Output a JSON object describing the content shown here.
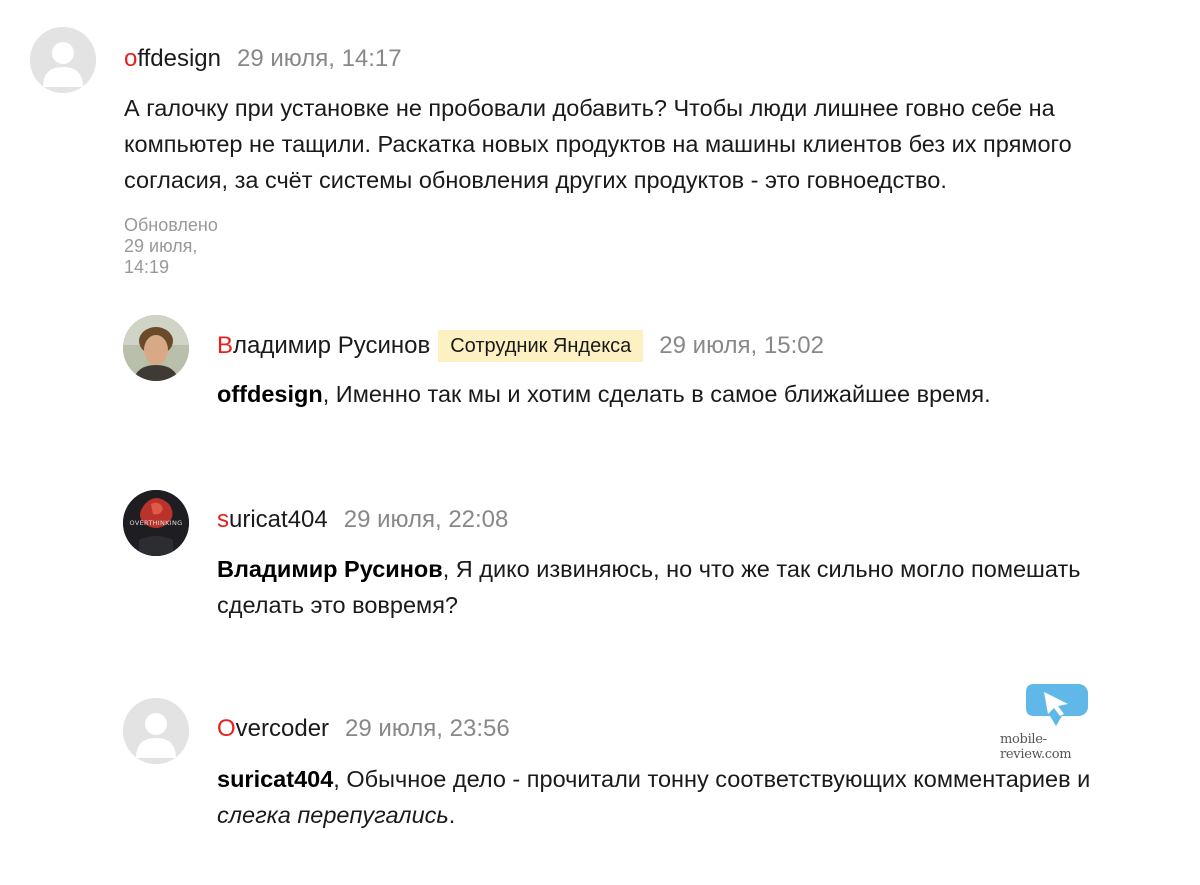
{
  "comments": [
    {
      "author_first": "o",
      "author_rest": "ffdesign",
      "time": "29 июля, 14:17",
      "text": "А галочку при установке не пробовали добавить? Чтобы люди лишнее говно себе на компьютер не тащили. Раскатка новых продуктов на машины клиентов без их прямого согласия, за счёт системы обновления других продуктов - это говноедство.",
      "updated": "Обновлено 29 июля, 14:19"
    },
    {
      "author_first": "В",
      "author_rest": "ладимир Русинов",
      "badge": "Сотрудник Яндекса",
      "time": "29 июля, 15:02",
      "mention": "offdesign",
      "text": ", Именно так мы и хотим сделать в самое ближайшее время."
    },
    {
      "author_first": "s",
      "author_rest": "uricat404",
      "time": "29 июля, 22:08",
      "mention": "Владимир Русинов",
      "text": ", Я дико извиняюсь, но что же так сильно могло помешать сделать это вовремя?"
    },
    {
      "author_first": "O",
      "author_rest": "vercoder",
      "time": "29 июля, 23:56",
      "mention": "suricat404",
      "text": ", Обычное дело - прочитали тонну соответствующих комментариев и ",
      "emphasis": "слегка перепугались",
      "text_end": "."
    }
  ],
  "watermark": {
    "text": "mobile-review.com",
    "icon": "arrow-cursor-icon"
  },
  "avatar_overthinking_text": "OVERTHINKING",
  "colors": {
    "author_first_letter": "#e8201d",
    "time": "#888888",
    "badge_bg": "#fdf0c2",
    "updated": "#999999"
  }
}
